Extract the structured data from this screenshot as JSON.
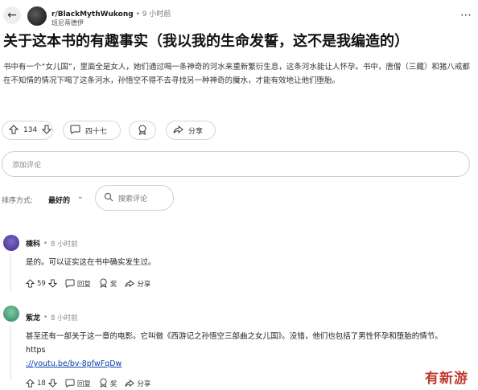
{
  "header": {
    "subreddit": "r/BlackMythWukong",
    "separator": "•",
    "time": "9 小时前",
    "username": "班尼蒂德伊",
    "back_icon": "←",
    "more_icon": "⋯"
  },
  "post": {
    "title": "关于这本书的有趣事实（我以我的生命发誓，这不是我编造的）",
    "body": "书中有一个“女儿国”，里面全是女人，她们通过喝一条神奇的河水来重新繁衍生息，这条河水能让人怀孕。书中，唐僧（三藏）和猪八戒都在不知情的情况下喝了这条河水，孙悟空不得不去寻找另一种神奇的魔水，才能有效地让他们堕胎。"
  },
  "actions": {
    "vote_count": "134",
    "comment_count": "四十七",
    "share_label": "分享"
  },
  "comment_box": {
    "placeholder": "添加评论"
  },
  "sort": {
    "label": "排序方式:",
    "value": "最好的",
    "search_placeholder": "搜索评论"
  },
  "comments": [
    {
      "name": "棟科",
      "sep": "•",
      "time": "8 小时前",
      "text": "是的。可以证实这在书中确实发生过。",
      "votes": "59",
      "reply_label": "回复",
      "award_label": "奖",
      "share_label": "分享"
    },
    {
      "name": "紫龙",
      "sep": "•",
      "time": "8 小时前",
      "text": "甚至还有一部关于这一章的电影。它叫做《西游记之孙悟空三部曲之女儿国》。没错，他们也包括了男性怀孕和堕胎的情节。https",
      "link": "://youtu.be/bv-8pfwFqDw",
      "votes": "18",
      "reply_label": "回复",
      "award_label": "奖",
      "share_label": "分享"
    }
  ],
  "watermark": "有新游",
  "colors": {
    "link": "#0b3fa8",
    "watermark": "#c0392b"
  }
}
